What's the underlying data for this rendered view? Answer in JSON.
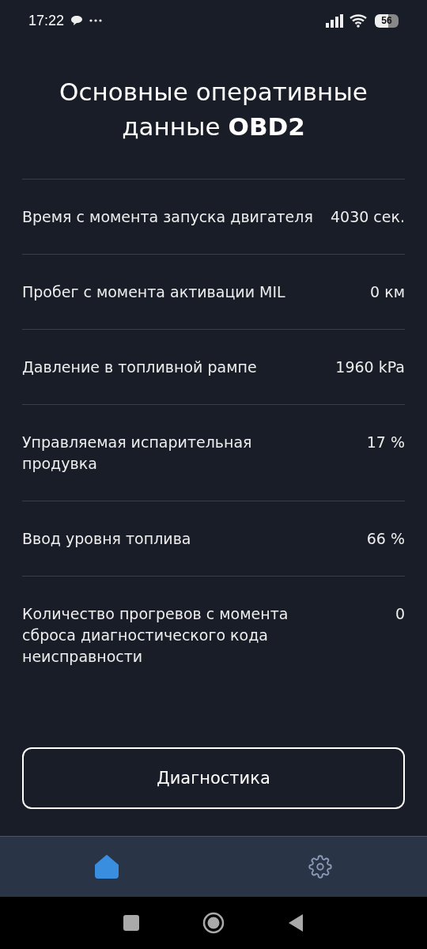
{
  "status_bar": {
    "time": "17:22",
    "battery": "56"
  },
  "title": "Основные оперативные данные **OBD2**",
  "rows": [
    {
      "label": "Время с момента запуска двигателя",
      "value": "4030 сек."
    },
    {
      "label": "Пробег с момента активации MIL",
      "value": "0 км"
    },
    {
      "label": "Давление в топливной рампе",
      "value": "1960 kPa"
    },
    {
      "label": "Управляемая испарительная продувка",
      "value": "17 %"
    },
    {
      "label": "Ввод уровня топлива",
      "value": "66 %"
    },
    {
      "label": "Количество прогревов с момента сброса диагностического кода неисправности",
      "value": "0"
    }
  ],
  "button": "Диагностика",
  "bottom_nav": [
    {
      "kind": "home",
      "selected": true
    },
    {
      "kind": "settings",
      "selected": false
    }
  ]
}
